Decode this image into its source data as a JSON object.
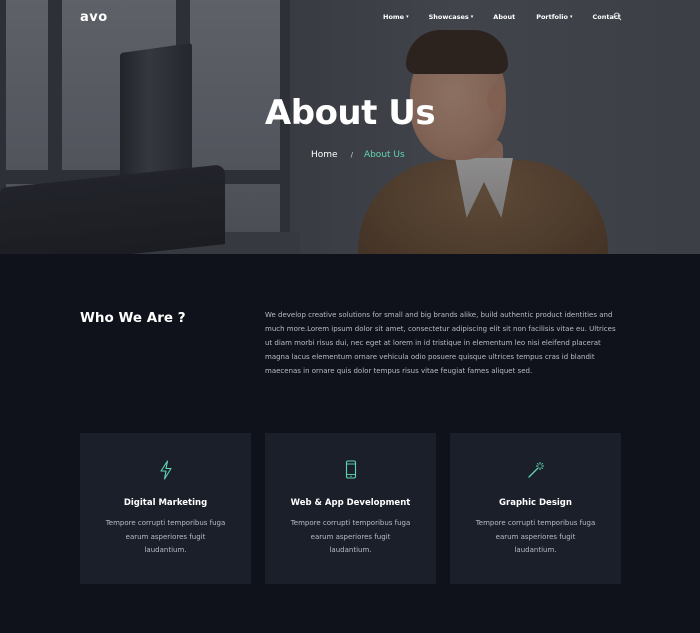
{
  "header": {
    "logo": "avo",
    "nav": [
      {
        "label": "Home",
        "dropdown": true
      },
      {
        "label": "Showcases",
        "dropdown": true
      },
      {
        "label": "About",
        "dropdown": false
      },
      {
        "label": "Portfolio",
        "dropdown": true
      },
      {
        "label": "Contact",
        "dropdown": false
      }
    ],
    "search_icon": "search-icon"
  },
  "hero": {
    "title": "About Us",
    "breadcrumb": {
      "home": "Home",
      "separator": "/",
      "current": "About Us"
    }
  },
  "about": {
    "title": "Who We Are ?",
    "text": "We develop creative solutions for small and big brands alike, build authentic product identities and much more.Lorem ipsum dolor sit amet, consectetur adipiscing elit sit non facilisis vitae eu. Ultrices ut diam morbi risus dui, nec eget at lorem in id tristique in elementum leo nisi eleifend placerat magna lacus elementum ornare vehicula odio posuere quisque ultrices tempus cras id blandit maecenas in ornare quis dolor tempus risus vitae feugiat fames aliquet sed."
  },
  "services": [
    {
      "icon": "lightning-icon",
      "title": "Digital Marketing",
      "desc": "Tempore corrupti temporibus fuga earum asperiores fugit laudantium."
    },
    {
      "icon": "smartphone-icon",
      "title": "Web & App Development",
      "desc": "Tempore corrupti temporibus fuga earum asperiores fugit laudantium."
    },
    {
      "icon": "magic-wand-icon",
      "title": "Graphic Design",
      "desc": "Tempore corrupti temporibus fuga earum asperiores fugit laudantium."
    }
  ],
  "colors": {
    "accent": "#5fd6b2",
    "background": "#0f121a",
    "card": "#1b1f2a"
  }
}
